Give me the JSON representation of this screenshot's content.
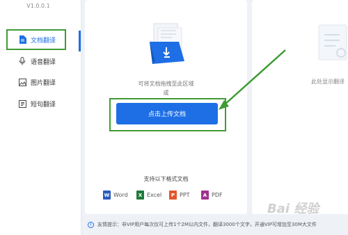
{
  "app": {
    "version": "V1.0.0.1"
  },
  "sidebar": {
    "items": [
      {
        "label": "文档翻译",
        "icon": "document-icon"
      },
      {
        "label": "语音翻译",
        "icon": "microphone-icon"
      },
      {
        "label": "图片翻译",
        "icon": "image-icon"
      },
      {
        "label": "短句翻译",
        "icon": "text-icon"
      }
    ],
    "active_index": 0
  },
  "upload": {
    "hint_line1": "可将文档拖拽至此区域",
    "hint_line2": "或",
    "button_label": "点击上传文档"
  },
  "formats": {
    "title": "支持以下格式文档",
    "items": [
      {
        "label": "Word",
        "badge": "W",
        "color": "#2b5bbf"
      },
      {
        "label": "Excel",
        "badge": "X",
        "color": "#1f7a3d"
      },
      {
        "label": "PPT",
        "badge": "P",
        "color": "#e2572b"
      },
      {
        "label": "PDF",
        "badge": "A",
        "color": "#a0328f"
      }
    ]
  },
  "preview": {
    "hint": "此处显示翻译"
  },
  "footer": {
    "text": "友情提示：非VIP用户每次仅可上传1个2M以内文件，翻译3000个文字，开通VIP可增加至30M大文件"
  },
  "watermark": "Bai 经验",
  "colors": {
    "accent": "#1e6fe6",
    "annotation_green": "#3f9b34"
  }
}
